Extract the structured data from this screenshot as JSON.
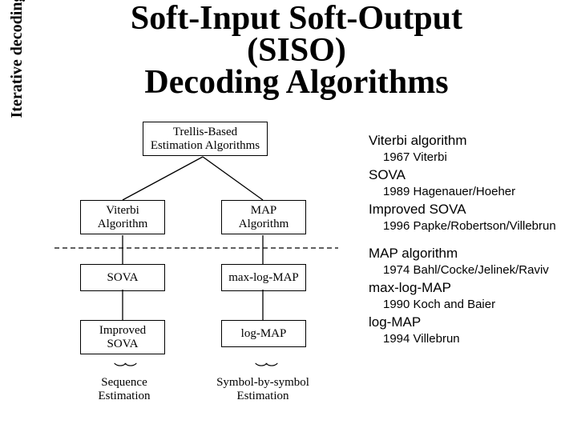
{
  "title_l1": "Soft-Input Soft-Output",
  "title_l2": "(SISO)",
  "title_l3": "Decoding Algorithms",
  "sidebar": "Iterative decoding",
  "root_l1": "Trellis-Based",
  "root_l2": "Estimation Algorithms",
  "va_l1": "Viterbi",
  "va_l2": "Algorithm",
  "map_l1": "MAP",
  "map_l2": "Algorithm",
  "sova": "SOVA",
  "mlm": "max-log-MAP",
  "isova_l1": "Improved",
  "isova_l2": "SOVA",
  "lmap": "log-MAP",
  "seq_l1": "Sequence",
  "seq_l2": "Estimation",
  "sym_l1": "Symbol-by-symbol",
  "sym_l2": "Estimation",
  "r_va": "Viterbi algorithm",
  "r_va_s": "1967 Viterbi",
  "r_sova": "SOVA",
  "r_sova_s": "1989 Hagenauer/Hoeher",
  "r_isova": "Improved SOVA",
  "r_isova_s": "1996 Papke/Robertson/Villebrun",
  "r_map": "MAP algorithm",
  "r_map_s": "1974 Bahl/Cocke/Jelinek/Raviv",
  "r_mlm": "max-log-MAP",
  "r_mlm_s": "1990 Koch and Baier",
  "r_lmap": "log-MAP",
  "r_lmap_s": "1994 Villebrun"
}
